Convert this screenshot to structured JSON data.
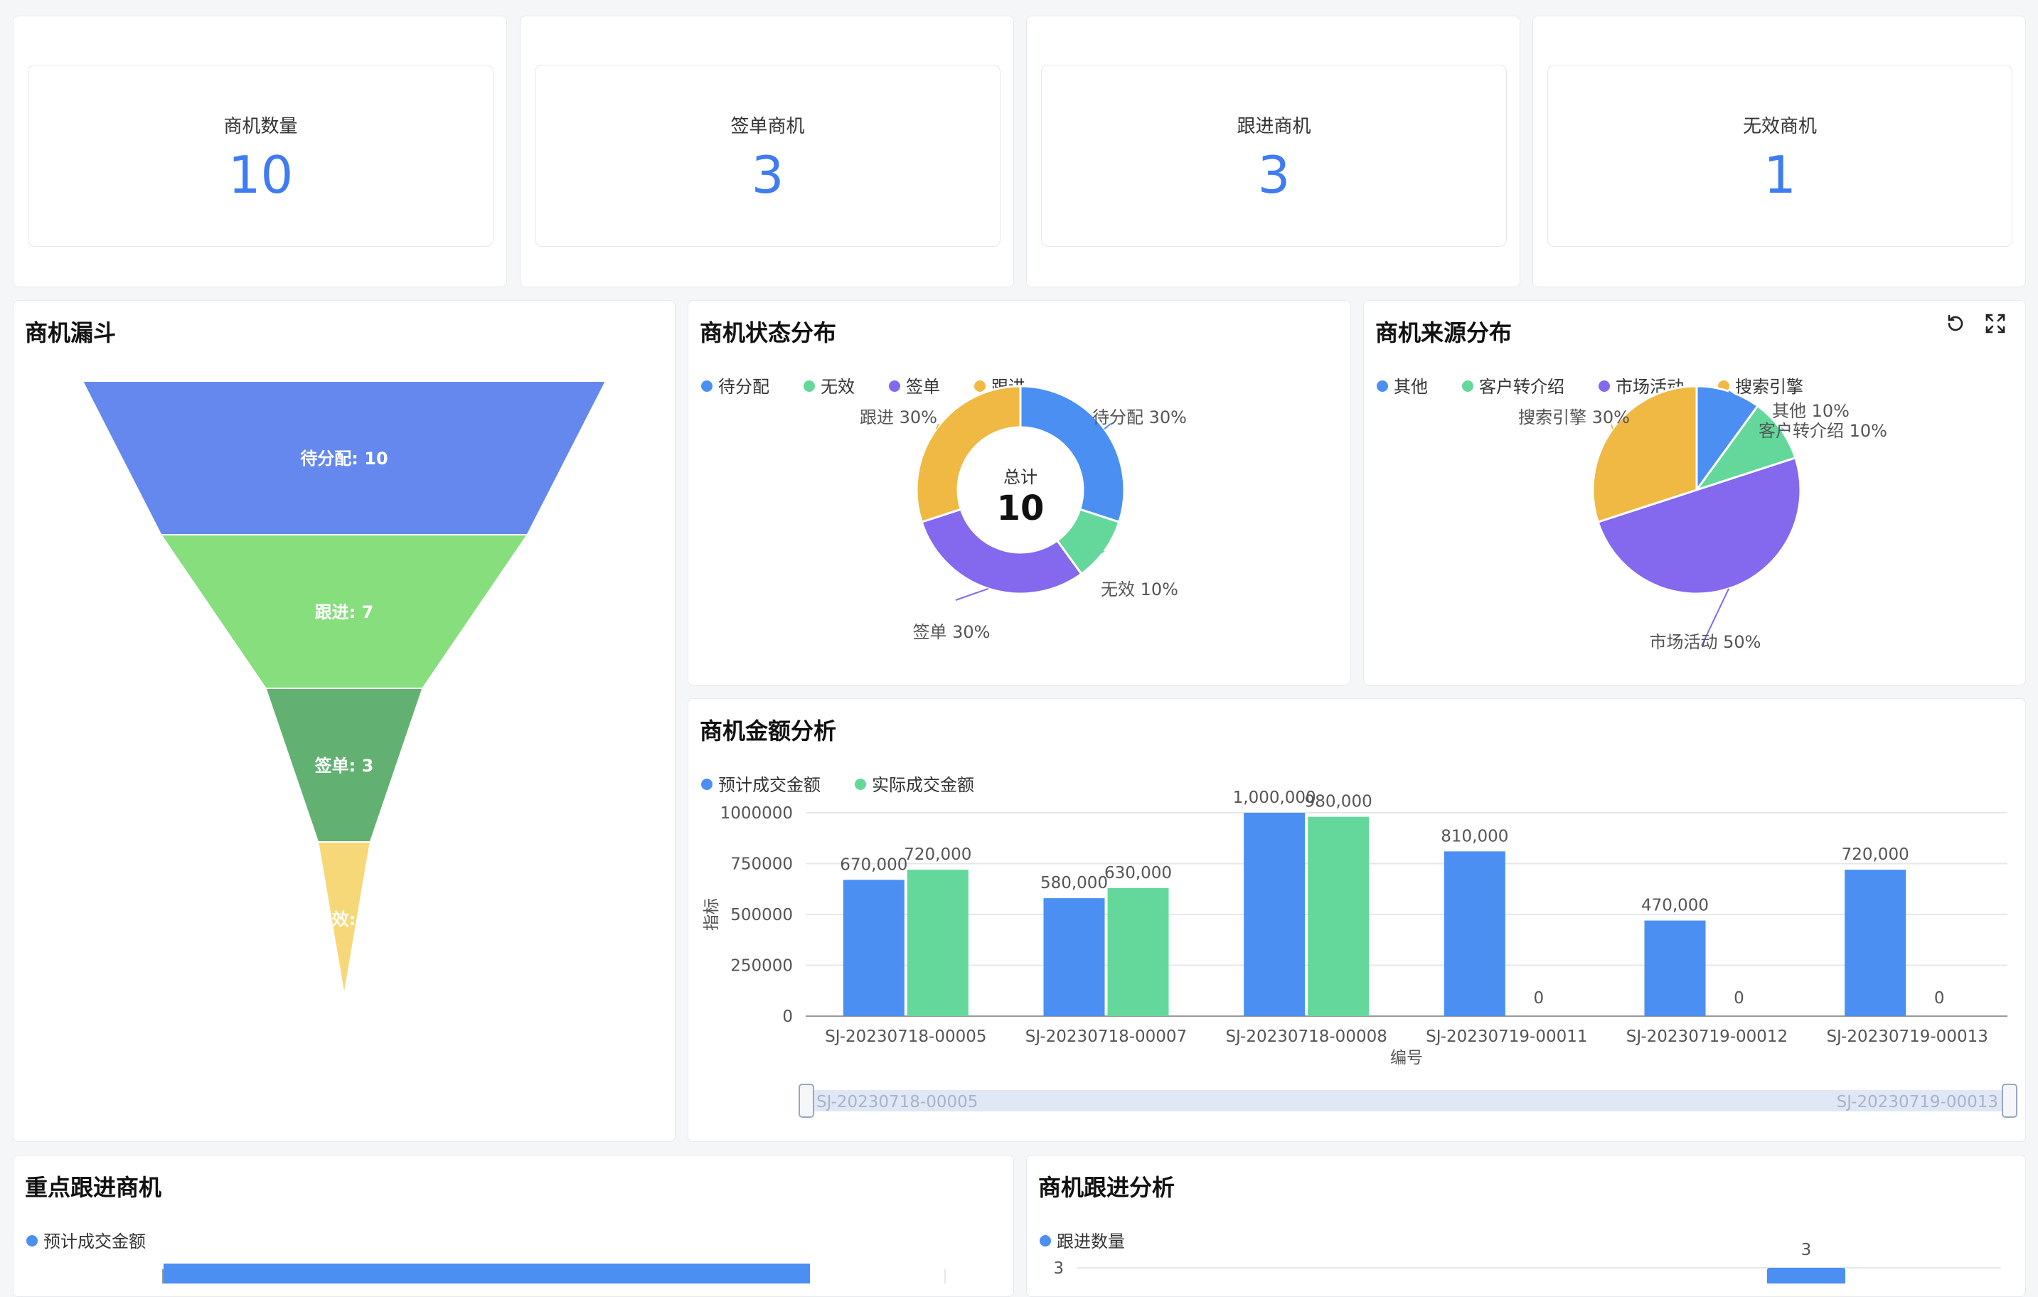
{
  "kpis": [
    {
      "label": "商机数量",
      "value": "10"
    },
    {
      "label": "签单商机",
      "value": "3"
    },
    {
      "label": "跟进商机",
      "value": "3"
    },
    {
      "label": "无效商机",
      "value": "1"
    }
  ],
  "panels": {
    "funnel": "商机漏斗",
    "status": "商机状态分布",
    "source": "商机来源分布",
    "amount": "商机金额分析",
    "key": "重点跟进商机",
    "followup": "商机跟进分析"
  },
  "chart_data": [
    {
      "type": "funnel",
      "title": "商机漏斗",
      "categories": [
        "待分配",
        "跟进",
        "签单",
        "无效"
      ],
      "values": [
        10,
        7,
        3,
        1
      ],
      "labels": [
        "待分配: 10",
        "跟进: 7",
        "签单: 3",
        "无效: 1"
      ],
      "colors": [
        "#6488ee",
        "#86de7c",
        "#63b172",
        "#f7d878"
      ]
    },
    {
      "type": "pie",
      "variant": "donut",
      "title": "商机状态分布",
      "categories": [
        "待分配",
        "无效",
        "签单",
        "跟进"
      ],
      "values": [
        30,
        10,
        30,
        30
      ],
      "labels": [
        "待分配 30%",
        "无效 10%",
        "签单 30%",
        "跟进 30%"
      ],
      "colors": [
        "#4b8ff2",
        "#64d89b",
        "#8468ee",
        "#f0b944"
      ],
      "center_label": "总计",
      "center_value": "10",
      "legend": "top-left"
    },
    {
      "type": "pie",
      "title": "商机来源分布",
      "categories": [
        "其他",
        "客户转介绍",
        "市场活动",
        "搜索引擎"
      ],
      "values": [
        10,
        10,
        50,
        30
      ],
      "labels": [
        "其他 10%",
        "客户转介绍 10%",
        "市场活动 50%",
        "搜索引擎 30%"
      ],
      "colors": [
        "#4b8ff2",
        "#64d89b",
        "#8468ee",
        "#f0b944"
      ],
      "legend": "top-left"
    },
    {
      "type": "bar",
      "title": "商机金额分析",
      "categories": [
        "SJ-20230718-00005",
        "SJ-20230718-00007",
        "SJ-20230718-00008",
        "SJ-20230719-00011",
        "SJ-20230719-00012",
        "SJ-20230719-00013"
      ],
      "series": [
        {
          "name": "预计成交金额",
          "values": [
            670000,
            580000,
            1000000,
            810000,
            470000,
            720000
          ],
          "labels": [
            "670,000",
            "580,000",
            "1,000,000",
            "810,000",
            "470,000",
            "720,000"
          ],
          "color": "#4b8ff2"
        },
        {
          "name": "实际成交金额",
          "values": [
            720000,
            630000,
            980000,
            0,
            0,
            0
          ],
          "labels": [
            "720,000",
            "630,000",
            "980,000",
            "0",
            "0",
            "0"
          ],
          "color": "#64d89b"
        }
      ],
      "xlabel": "编号",
      "ylabel": "指标",
      "ylim": [
        0,
        1000000
      ],
      "yticks": [
        "0",
        "250000",
        "500000",
        "750000",
        "1000000"
      ],
      "zoom_start": "SJ-20230718-00005",
      "zoom_end": "SJ-20230719-00013",
      "legend": "top-left",
      "grid": true
    },
    {
      "type": "bar",
      "orientation": "horizontal",
      "title": "重点跟进商机",
      "series": [
        {
          "name": "预计成交金额",
          "color": "#4b8ff2"
        }
      ],
      "legend": "top-left"
    },
    {
      "type": "bar",
      "title": "商机跟进分析",
      "series": [
        {
          "name": "跟进数量",
          "values": [
            3
          ],
          "labels": [
            "3"
          ],
          "color": "#4b8ff2"
        }
      ],
      "yticks": [
        "3"
      ],
      "legend": "top-left"
    }
  ]
}
